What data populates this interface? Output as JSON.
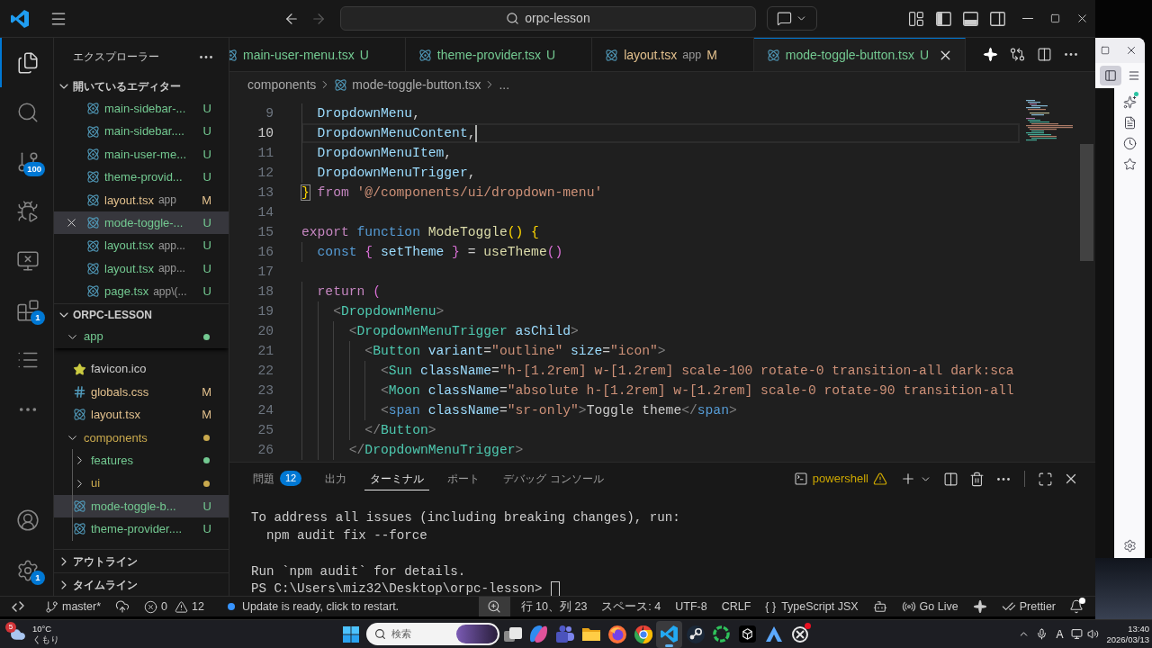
{
  "title_bar": {
    "navigation": [
      {
        "kind": "back",
        "disabled": false
      },
      {
        "kind": "forward",
        "disabled": true
      }
    ],
    "search": "orpc-lesson",
    "layout_toggles": [
      {
        "kind": "sidebar",
        "on": true
      },
      {
        "kind": "panel",
        "on": true
      },
      {
        "kind": "secondary_sidebar",
        "on": false
      }
    ]
  },
  "activity_bar": {
    "items": [
      {
        "kind": "explorer",
        "selected": true
      },
      {
        "kind": "search",
        "selected": false
      },
      {
        "kind": "source_control",
        "selected": false,
        "badge": "100"
      },
      {
        "kind": "run_debug",
        "selected": false
      },
      {
        "kind": "remote_explorer",
        "selected": false
      },
      {
        "kind": "extensions",
        "selected": false,
        "badge": "1"
      },
      {
        "kind": "testing",
        "selected": false
      },
      {
        "kind": "more",
        "selected": false
      }
    ],
    "bottom": [
      {
        "kind": "accounts"
      },
      {
        "kind": "manage",
        "badge": "1"
      }
    ]
  },
  "sidebar": {
    "title": "エクスプローラー",
    "open_editors": {
      "title": "開いているエディター",
      "expanded": true,
      "items": [
        {
          "kind": "react",
          "name": "main-sidebar-...",
          "status": "U",
          "color": "#73c991",
          "selected": false
        },
        {
          "kind": "react",
          "name": "main-sidebar....",
          "status": "U",
          "color": "#73c991",
          "selected": false
        },
        {
          "kind": "react",
          "name": "main-user-me...",
          "status": "U",
          "color": "#73c991",
          "selected": false
        },
        {
          "kind": "react",
          "name": "theme-provid...",
          "status": "U",
          "color": "#73c991",
          "selected": false
        },
        {
          "kind": "react",
          "name": "layout.tsx",
          "description": "app",
          "status": "M",
          "color": "#e2c08d",
          "selected": false
        },
        {
          "kind": "react",
          "name": "mode-toggle-...",
          "status": "U",
          "color": "#73c991",
          "selected": true
        },
        {
          "kind": "react",
          "name": "layout.tsx",
          "description": "app...",
          "status": "U",
          "color": "#73c991",
          "selected": false
        },
        {
          "kind": "react",
          "name": "layout.tsx",
          "description": "app...",
          "status": "U",
          "color": "#73c991",
          "selected": false
        },
        {
          "kind": "react",
          "name": "page.tsx",
          "description": "app\\(...",
          "status": "U",
          "color": "#73c991",
          "selected": false
        }
      ]
    },
    "project": {
      "title": "ORPC-LESSON",
      "expanded": true,
      "tree": [
        {
          "kind": "folder",
          "name": "app",
          "expanded": true,
          "color": "#73c991",
          "selected": false,
          "children": [
            {
              "kind": "favicon",
              "name": "favicon.ico",
              "selected": false
            },
            {
              "kind": "css",
              "name": "globals.css",
              "status": "M",
              "color": "#e2c08d",
              "selected": false
            },
            {
              "kind": "react",
              "name": "layout.tsx",
              "status": "M",
              "color": "#e2c08d",
              "selected": false
            }
          ]
        },
        {
          "kind": "folder",
          "name": "components",
          "expanded": true,
          "color": "#c9a94d",
          "selected": false,
          "children": [
            {
              "kind": "folder",
              "name": "features",
              "expanded": false,
              "color": "#73c991",
              "selected": false
            },
            {
              "kind": "folder",
              "name": "ui",
              "expanded": false,
              "color": "#c9a94d",
              "selected": false
            },
            {
              "kind": "react",
              "name": "mode-toggle-b...",
              "status": "U",
              "color": "#73c991",
              "selected": true
            },
            {
              "kind": "react",
              "name": "theme-provider....",
              "status": "U",
              "color": "#73c991",
              "selected": false
            }
          ]
        }
      ]
    },
    "collapsed_sections": [
      {
        "title": "アウトライン",
        "expanded": false
      },
      {
        "title": "タイムライン",
        "expanded": false
      }
    ]
  },
  "editor": {
    "tabs": [
      {
        "name": "main-user-menu.tsx",
        "status": "U",
        "color": "#73c991",
        "selected": false
      },
      {
        "name": "theme-provider.tsx",
        "status": "U",
        "color": "#73c991",
        "selected": false
      },
      {
        "name": "layout.tsx",
        "description": "app",
        "status": "M",
        "color": "#e2c08d",
        "selected": false
      },
      {
        "name": "mode-toggle-button.tsx",
        "status": "U",
        "color": "#73c991",
        "selected": true
      }
    ],
    "breadcrumbs": [
      {
        "kind": "folder",
        "text": "components"
      },
      {
        "kind": "react",
        "text": "mode-toggle-button.tsx"
      },
      {
        "kind": "symbol",
        "text": "..."
      }
    ],
    "lines": [
      {
        "number": "9",
        "current": false,
        "tokens": [
          {
            "text": "  DropdownMenu",
            "kind": "variable"
          },
          {
            "text": ",",
            "kind": "plain"
          }
        ]
      },
      {
        "number": "10",
        "current": true,
        "tokens": [
          {
            "text": "  DropdownMenuContent",
            "kind": "variable"
          },
          {
            "text": ",",
            "kind": "plain"
          }
        ]
      },
      {
        "number": "11",
        "current": false,
        "tokens": [
          {
            "text": "  DropdownMenuItem",
            "kind": "variable"
          },
          {
            "text": ",",
            "kind": "plain"
          }
        ]
      },
      {
        "number": "12",
        "current": false,
        "tokens": [
          {
            "text": "  DropdownMenuTrigger",
            "kind": "variable"
          },
          {
            "text": ",",
            "kind": "plain"
          }
        ]
      },
      {
        "number": "13",
        "current": false,
        "tokens": [
          {
            "text": "}",
            "kind": "bracket_match"
          },
          {
            "text": " from ",
            "kind": "control"
          },
          {
            "text": "'@/components/ui/dropdown-menu'",
            "kind": "string"
          }
        ]
      },
      {
        "number": "14",
        "current": false
      },
      {
        "number": "15",
        "current": false,
        "tokens": [
          {
            "text": "export",
            "kind": "control"
          },
          {
            "text": " function ",
            "kind": "keyword"
          },
          {
            "text": "ModeToggle",
            "kind": "function"
          },
          {
            "text": "()",
            "kind": "bracket1"
          },
          {
            "text": " {",
            "kind": "bracket1"
          }
        ]
      },
      {
        "number": "16",
        "current": false,
        "tokens": [
          {
            "text": "  const",
            "kind": "keyword"
          },
          {
            "text": " { ",
            "kind": "bracket2"
          },
          {
            "text": "setTheme",
            "kind": "variable"
          },
          {
            "text": " }",
            "kind": "bracket2"
          },
          {
            "text": " = ",
            "kind": "plain"
          },
          {
            "text": "useTheme",
            "kind": "function"
          },
          {
            "text": "()",
            "kind": "bracket2"
          }
        ]
      },
      {
        "number": "17",
        "current": false
      },
      {
        "number": "18",
        "current": false,
        "tokens": [
          {
            "text": "  return",
            "kind": "control"
          },
          {
            "text": " (",
            "kind": "bracket2"
          }
        ]
      },
      {
        "number": "19",
        "current": false,
        "tokens": [
          {
            "text": "    <",
            "kind": "tag_punct"
          },
          {
            "text": "DropdownMenu",
            "kind": "component"
          },
          {
            "text": ">",
            "kind": "tag_punct"
          }
        ]
      },
      {
        "number": "20",
        "current": false,
        "tokens": [
          {
            "text": "      <",
            "kind": "tag_punct"
          },
          {
            "text": "DropdownMenuTrigger",
            "kind": "component"
          },
          {
            "text": " asChild",
            "kind": "variable"
          },
          {
            "text": ">",
            "kind": "tag_punct"
          }
        ]
      },
      {
        "number": "21",
        "current": false,
        "tokens": [
          {
            "text": "        <",
            "kind": "tag_punct"
          },
          {
            "text": "Button",
            "kind": "component"
          },
          {
            "text": " variant",
            "kind": "variable"
          },
          {
            "text": "=",
            "kind": "plain"
          },
          {
            "text": "\"outline\"",
            "kind": "string"
          },
          {
            "text": " size",
            "kind": "variable"
          },
          {
            "text": "=",
            "kind": "plain"
          },
          {
            "text": "\"icon\"",
            "kind": "string"
          },
          {
            "text": ">",
            "kind": "tag_punct"
          }
        ]
      },
      {
        "number": "22",
        "current": false,
        "tokens": [
          {
            "text": "          <",
            "kind": "tag_punct"
          },
          {
            "text": "Sun",
            "kind": "component"
          },
          {
            "text": " className",
            "kind": "variable"
          },
          {
            "text": "=",
            "kind": "plain"
          },
          {
            "text": "\"h-[1.2rem] w-[1.2rem] scale-100 rotate-0 transition-all dark:sca",
            "kind": "string"
          }
        ]
      },
      {
        "number": "23",
        "current": false,
        "tokens": [
          {
            "text": "          <",
            "kind": "tag_punct"
          },
          {
            "text": "Moon",
            "kind": "component"
          },
          {
            "text": " className",
            "kind": "variable"
          },
          {
            "text": "=",
            "kind": "plain"
          },
          {
            "text": "\"absolute h-[1.2rem] w-[1.2rem] scale-0 rotate-90 transition-all",
            "kind": "string"
          }
        ]
      },
      {
        "number": "24",
        "current": false,
        "tokens": [
          {
            "text": "          <",
            "kind": "tag_punct"
          },
          {
            "text": "span",
            "kind": "keyword"
          },
          {
            "text": " className",
            "kind": "variable"
          },
          {
            "text": "=",
            "kind": "plain"
          },
          {
            "text": "\"sr-only\"",
            "kind": "string"
          },
          {
            "text": ">",
            "kind": "tag_punct"
          },
          {
            "text": "Toggle theme",
            "kind": "plain"
          },
          {
            "text": "</",
            "kind": "tag_punct"
          },
          {
            "text": "span",
            "kind": "keyword"
          },
          {
            "text": ">",
            "kind": "tag_punct"
          }
        ]
      },
      {
        "number": "25",
        "current": false,
        "tokens": [
          {
            "text": "        </",
            "kind": "tag_punct"
          },
          {
            "text": "Button",
            "kind": "component"
          },
          {
            "text": ">",
            "kind": "tag_punct"
          }
        ]
      },
      {
        "number": "26",
        "current": false,
        "tokens": [
          {
            "text": "      </",
            "kind": "tag_punct"
          },
          {
            "text": "DropdownMenuTrigger",
            "kind": "component"
          },
          {
            "text": ">",
            "kind": "tag_punct"
          }
        ]
      }
    ]
  },
  "panel": {
    "tabs": [
      {
        "label": "問題",
        "badge": "12",
        "selected": false
      },
      {
        "label": "出力",
        "selected": false
      },
      {
        "label": "ターミナル",
        "selected": true
      },
      {
        "label": "ポート",
        "selected": false
      },
      {
        "label": "デバッグ コンソール",
        "selected": false
      }
    ],
    "terminal": {
      "name": "powershell",
      "output": [
        [
          "To address all issues (including breaking changes), run:",
          "  npm audit fix --force"
        ],
        [
          "Run `npm audit` for details."
        ]
      ],
      "prompt": "PS C:\\Users\\miz32\\Desktop\\orpc-lesson>"
    }
  },
  "status_bar": {
    "left": [
      {
        "kind": "remote"
      },
      {
        "kind": "branch",
        "text": "master*"
      },
      {
        "kind": "publish"
      },
      {
        "kind": "problems",
        "errors": "0",
        "warnings": "12"
      },
      {
        "kind": "update",
        "text": "Update is ready, click to restart."
      }
    ],
    "zoom": {
      "highlighted": true
    },
    "right": [
      {
        "kind": "text",
        "text": "行 10、列 23"
      },
      {
        "kind": "text",
        "text": "スペース: 4"
      },
      {
        "kind": "text",
        "text": "UTF-8"
      },
      {
        "kind": "text",
        "text": "CRLF"
      },
      {
        "kind": "language",
        "icon": "{ }",
        "text": "TypeScript JSX"
      },
      {
        "kind": "assistant"
      },
      {
        "kind": "live",
        "text": "Go Live"
      },
      {
        "kind": "sparkle"
      },
      {
        "kind": "formatter",
        "text": "Prettier"
      }
    ],
    "notifications": {
      "dot": true
    }
  },
  "browser": {
    "sidebar_button": {
      "on": true
    },
    "sidebar_icons": [
      {
        "kind": "assistant",
        "dot": true
      },
      {
        "kind": "page_tool",
        "dot": false
      },
      {
        "kind": "history",
        "dot": false
      },
      {
        "kind": "bookmarks",
        "dot": false
      }
    ]
  },
  "taskbar": {
    "weather": {
      "badge": "5",
      "temperature": "10°C",
      "condition": "くもり"
    },
    "search": {
      "placeholder": "検索"
    },
    "apps": [
      {
        "kind": "task_view",
        "active": false,
        "dot": false
      },
      {
        "kind": "swirl",
        "active": false,
        "dot": false
      },
      {
        "kind": "people",
        "active": false,
        "dot": false
      },
      {
        "kind": "folder",
        "active": false,
        "dot": false
      },
      {
        "kind": "browser_a",
        "active": false,
        "dot": false
      },
      {
        "kind": "browser_b",
        "active": false,
        "dot": false
      },
      {
        "kind": "editor",
        "active": true,
        "dot": false
      },
      {
        "kind": "disc",
        "active": false,
        "dot": false
      },
      {
        "kind": "ring",
        "active": false,
        "dot": false
      },
      {
        "kind": "cube",
        "active": false,
        "dot": false
      },
      {
        "kind": "triangle",
        "active": false,
        "dot": false
      },
      {
        "kind": "knot",
        "active": false,
        "dot": true
      }
    ],
    "tray": {
      "ime": "A"
    },
    "clock": {
      "time": "13:40",
      "date": "2026/03/13"
    }
  }
}
